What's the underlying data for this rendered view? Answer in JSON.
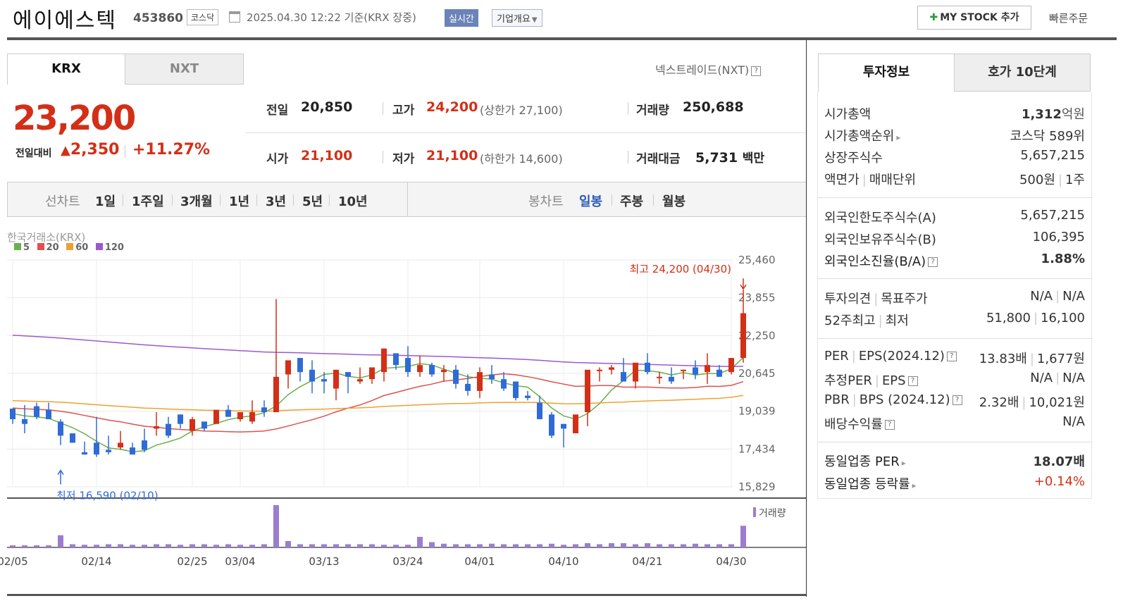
{
  "header": {
    "name": "에이에스텍",
    "code": "453860",
    "market": "코스닥",
    "datetime": "2025.04.30 12:22 기준(KRX 장중)",
    "live_label": "실시간",
    "company_label": "기업개요",
    "mystock_label": "MY STOCK 추가",
    "quick_order": "빠른주문"
  },
  "exchange_tabs": {
    "krx": "KRX",
    "nxt": "NXT",
    "nxt_link": "넥스트레이드(NXT)"
  },
  "price": {
    "current": "23,200",
    "compare_label": "전일대비",
    "change": "2,350",
    "rate": "+11.27%",
    "prev_label": "전일",
    "prev": "20,850",
    "high_label": "고가",
    "high": "24,200",
    "upper_limit": "(상한가 27,100)",
    "volume_label": "거래량",
    "volume": "250,688",
    "open_label": "시가",
    "open": "21,100",
    "low_label": "저가",
    "low": "21,100",
    "lower_limit": "(하한가 14,600)",
    "amount_label": "거래대금",
    "amount": "5,731",
    "amount_unit": "백만"
  },
  "range_bar": {
    "line_label": "선차트",
    "line_options": [
      "1일",
      "1주일",
      "3개월",
      "1년",
      "3년",
      "5년",
      "10년"
    ],
    "candle_label": "봉차트",
    "candle_options": [
      "일봉",
      "주봉",
      "월봉"
    ],
    "candle_selected": "일봉"
  },
  "chart_data": {
    "type": "candlestick",
    "source": "한국거래소(KRX)",
    "ma_legend": [
      {
        "name": "5",
        "color": "#6ab04c"
      },
      {
        "name": "20",
        "color": "#e05050"
      },
      {
        "name": "60",
        "color": "#f0a030"
      },
      {
        "name": "120",
        "color": "#9b59d0"
      }
    ],
    "yticks": [
      25460,
      23855,
      22250,
      20645,
      19039,
      17434,
      15829
    ],
    "ylim": [
      15829,
      25460
    ],
    "xtick_labels": [
      "02/05",
      "02/14",
      "02/25",
      "03/04",
      "03/13",
      "03/24",
      "04/01",
      "04/10",
      "04/21",
      "04/30"
    ],
    "xtick_index": [
      0,
      7,
      15,
      19,
      26,
      33,
      39,
      46,
      53,
      60
    ],
    "high_annotation": "최고 24,200 (04/30)",
    "low_annotation": "최저 16,590 (02/10)",
    "volume_label": "거래량",
    "candles": [
      [
        19150,
        19000,
        18700,
        18500
      ],
      [
        18700,
        19300,
        18500,
        18100
      ],
      [
        19250,
        19400,
        18800,
        18700
      ],
      [
        19100,
        19400,
        18700,
        18700
      ],
      [
        18600,
        18700,
        18000,
        17600
      ],
      [
        18100,
        17700,
        17700,
        17700
      ],
      [
        17300,
        17750,
        17200,
        17200
      ],
      [
        17700,
        18800,
        17200,
        17100
      ],
      [
        17400,
        18000,
        17300,
        17200
      ],
      [
        17500,
        18200,
        17700,
        17400
      ],
      [
        17500,
        17700,
        17200,
        17200
      ],
      [
        17800,
        18300,
        17400,
        17300
      ],
      [
        18300,
        19000,
        18400,
        18000
      ],
      [
        18500,
        18800,
        18000,
        17900
      ],
      [
        18900,
        18900,
        18500,
        18300
      ],
      [
        18200,
        18800,
        18700,
        18000
      ],
      [
        18600,
        18500,
        18300,
        18200
      ],
      [
        18500,
        19000,
        19100,
        18500
      ],
      [
        19100,
        19300,
        18800,
        18800
      ],
      [
        18700,
        19000,
        19000,
        18600
      ],
      [
        18600,
        19500,
        19000,
        18500
      ],
      [
        19200,
        19500,
        19000,
        18800
      ],
      [
        19000,
        23800,
        20500,
        19000
      ],
      [
        20600,
        21000,
        21200,
        20000
      ],
      [
        21300,
        21300,
        20700,
        20300
      ],
      [
        20800,
        21200,
        20300,
        19800
      ],
      [
        20400,
        20700,
        20300,
        19800
      ],
      [
        20000,
        20600,
        20800,
        19500
      ],
      [
        20700,
        20700,
        20500,
        19800
      ],
      [
        20300,
        20900,
        20400,
        20200
      ],
      [
        20400,
        20400,
        20900,
        20200
      ],
      [
        20700,
        21700,
        21700,
        20300
      ],
      [
        21500,
        21500,
        21000,
        20800
      ],
      [
        21300,
        21800,
        20700,
        20500
      ],
      [
        20700,
        21400,
        21000,
        20500
      ],
      [
        21000,
        21100,
        20600,
        20500
      ],
      [
        20700,
        21000,
        20800,
        20300
      ],
      [
        20800,
        21000,
        20200,
        20000
      ],
      [
        20200,
        20600,
        19900,
        19700
      ],
      [
        19900,
        20900,
        20700,
        19600
      ],
      [
        20600,
        21000,
        20400,
        20200
      ],
      [
        20400,
        20700,
        20000,
        19900
      ],
      [
        20300,
        19900,
        19600,
        19500
      ],
      [
        19700,
        19900,
        19600,
        19500
      ],
      [
        19400,
        19700,
        18700,
        18700
      ],
      [
        18900,
        19000,
        18000,
        17900
      ],
      [
        18500,
        18300,
        18300,
        17500
      ],
      [
        18100,
        18200,
        18900,
        18400
      ],
      [
        19000,
        19000,
        20800,
        18400
      ],
      [
        20800,
        20900,
        20800,
        20300
      ],
      [
        20800,
        21000,
        20900,
        20600
      ],
      [
        20700,
        21300,
        20300,
        20300
      ],
      [
        20300,
        20900,
        21100,
        20000
      ],
      [
        21100,
        21500,
        20700,
        20600
      ],
      [
        20500,
        20700,
        20500,
        20200
      ],
      [
        20500,
        20900,
        20300,
        20200
      ],
      [
        20800,
        20800,
        20800,
        20400
      ],
      [
        20900,
        21200,
        20600,
        20400
      ],
      [
        20700,
        21500,
        21000,
        20200
      ],
      [
        20800,
        21000,
        20500,
        20500
      ],
      [
        20700,
        21200,
        21300,
        20600
      ],
      [
        21300,
        24200,
        23200,
        21100
      ]
    ],
    "volumes": [
      4,
      4,
      4,
      4,
      23,
      6,
      5,
      5,
      6,
      6,
      5,
      5,
      6,
      6,
      5,
      6,
      6,
      5,
      6,
      5,
      5,
      6,
      80,
      12,
      6,
      6,
      6,
      6,
      6,
      6,
      6,
      5,
      5,
      5,
      20,
      10,
      7,
      6,
      6,
      6,
      7,
      6,
      6,
      6,
      6,
      7,
      5,
      6,
      8,
      6,
      8,
      8,
      6,
      8,
      6,
      6,
      6,
      7,
      6,
      6,
      6,
      41
    ],
    "ma5": [],
    "ma20": [],
    "ma60": [],
    "ma120": []
  },
  "invest": {
    "tab1": "투자정보",
    "tab2": "호가 10단계",
    "rows": [
      {
        "label": "시가총액",
        "value": "1,312",
        "unit": "억원"
      },
      {
        "label": "시가총액순위",
        "value": "코스닥 589위"
      },
      {
        "label": "상장주식수",
        "value": "5,657,215"
      },
      {
        "label": "액면가",
        "label2": "매매단위",
        "value": "500원",
        "value2": "1주"
      },
      {
        "label": "외국인한도주식수(A)",
        "value": "5,657,215"
      },
      {
        "label": "외국인보유주식수(B)",
        "value": "106,395"
      },
      {
        "label": "외국인소진율(B/A)",
        "value": "1.88%"
      },
      {
        "label": "투자의견",
        "label2": "목표주가",
        "value": "N/A",
        "value2": "N/A"
      },
      {
        "label": "52주최고",
        "label2": "최저",
        "value": "51,800",
        "value2": "16,100"
      },
      {
        "label": "PER",
        "label2": "EPS(2024.12)",
        "value": "13.83배",
        "value2": "1,677원"
      },
      {
        "label": "추정PER",
        "label2": "EPS",
        "value": "N/A",
        "value2": "N/A"
      },
      {
        "label": "PBR",
        "label2": "BPS (2024.12)",
        "value": "2.32배",
        "value2": "10,021원"
      },
      {
        "label": "배당수익률",
        "value": "N/A"
      },
      {
        "label": "동일업종 PER",
        "value": "18.07배"
      },
      {
        "label": "동일업종 등락률",
        "value": "+0.14%"
      }
    ]
  }
}
